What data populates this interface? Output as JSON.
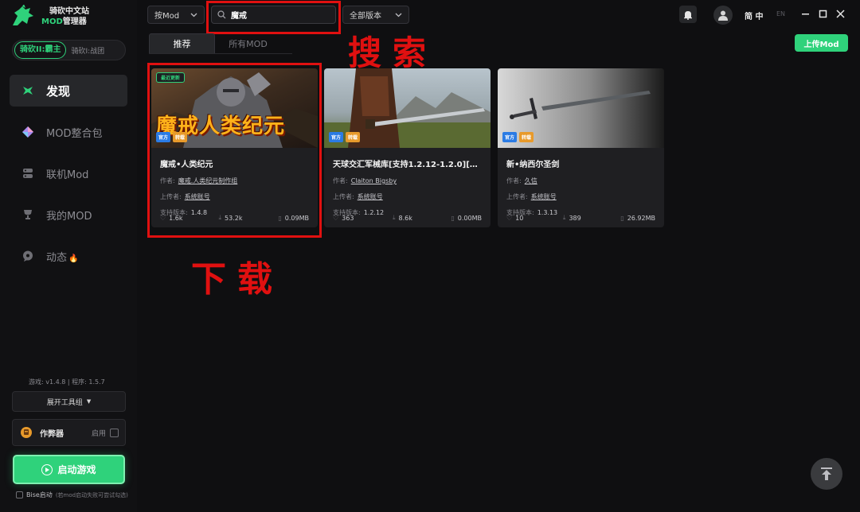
{
  "app": {
    "logo_line1": "骑砍中文站",
    "logo_mod": "MOD",
    "logo_line2_rest": "管理器"
  },
  "game_switch": {
    "active": "骑砍II:霸主",
    "other": "骑砍I:战团"
  },
  "nav": [
    {
      "label": "发现",
      "icon": "compass-icon"
    },
    {
      "label": "MOD整合包",
      "icon": "diamond-icon"
    },
    {
      "label": "联机Mod",
      "icon": "network-icon"
    },
    {
      "label": "我的MOD",
      "icon": "trophy-icon"
    },
    {
      "label": "动态",
      "icon": "chat-icon",
      "fire": "🔥"
    }
  ],
  "versions": {
    "game": "游戏: v1.4.8",
    "separator": "|",
    "program": "程序: 1.5.7"
  },
  "tools_button": "展开工具组",
  "cheat": {
    "label": "作弊器",
    "enable": "启用"
  },
  "launch_button": "启动游戏",
  "bise": {
    "label": "Bise启动",
    "hint": "(若mod启动失败可尝试勾选)"
  },
  "topbar": {
    "sort_select": "按Mod",
    "search_value": "魔戒",
    "version_select": "全部版本",
    "lang_zh": "简 中",
    "lang_en": "EN",
    "upload_button": "上传Mod"
  },
  "tabs": [
    "推荐",
    "所有MOD"
  ],
  "annotations": {
    "search": "搜索",
    "download": "下载"
  },
  "labels": {
    "author": "作者:",
    "uploader": "上传者:",
    "version": "支持版本:"
  },
  "cards": [
    {
      "title": "魔戒•人类纪元",
      "recent_badge": "最近更新",
      "image_text": "魔戒人类纪元",
      "badges": [
        "官方",
        "转载"
      ],
      "author": "魔戒.人类纪元制作组",
      "uploader": "系统账号",
      "version": "1.4.8",
      "likes": "1.6k",
      "downloads": "53.2k",
      "size": "0.09MB"
    },
    {
      "title": "天球交汇军械库[支持1.2.12-1.2.0][汉化...",
      "badges": [
        "官方",
        "转载"
      ],
      "author": "Claiton Bigsby",
      "uploader": "系统账号",
      "version": "1.2.12",
      "likes": "363",
      "downloads": "8.6k",
      "size": "0.00MB"
    },
    {
      "title": "新•纳西尔圣剑",
      "badges": [
        "官方",
        "转载"
      ],
      "author": "久信",
      "uploader": "系统账号",
      "version": "1.3.13",
      "likes": "10",
      "downloads": "389",
      "size": "26.92MB"
    }
  ],
  "colors": {
    "accent": "#2fd27b",
    "annotation": "#e01010",
    "official": "#2b7be4",
    "repost": "#e89a2b"
  }
}
